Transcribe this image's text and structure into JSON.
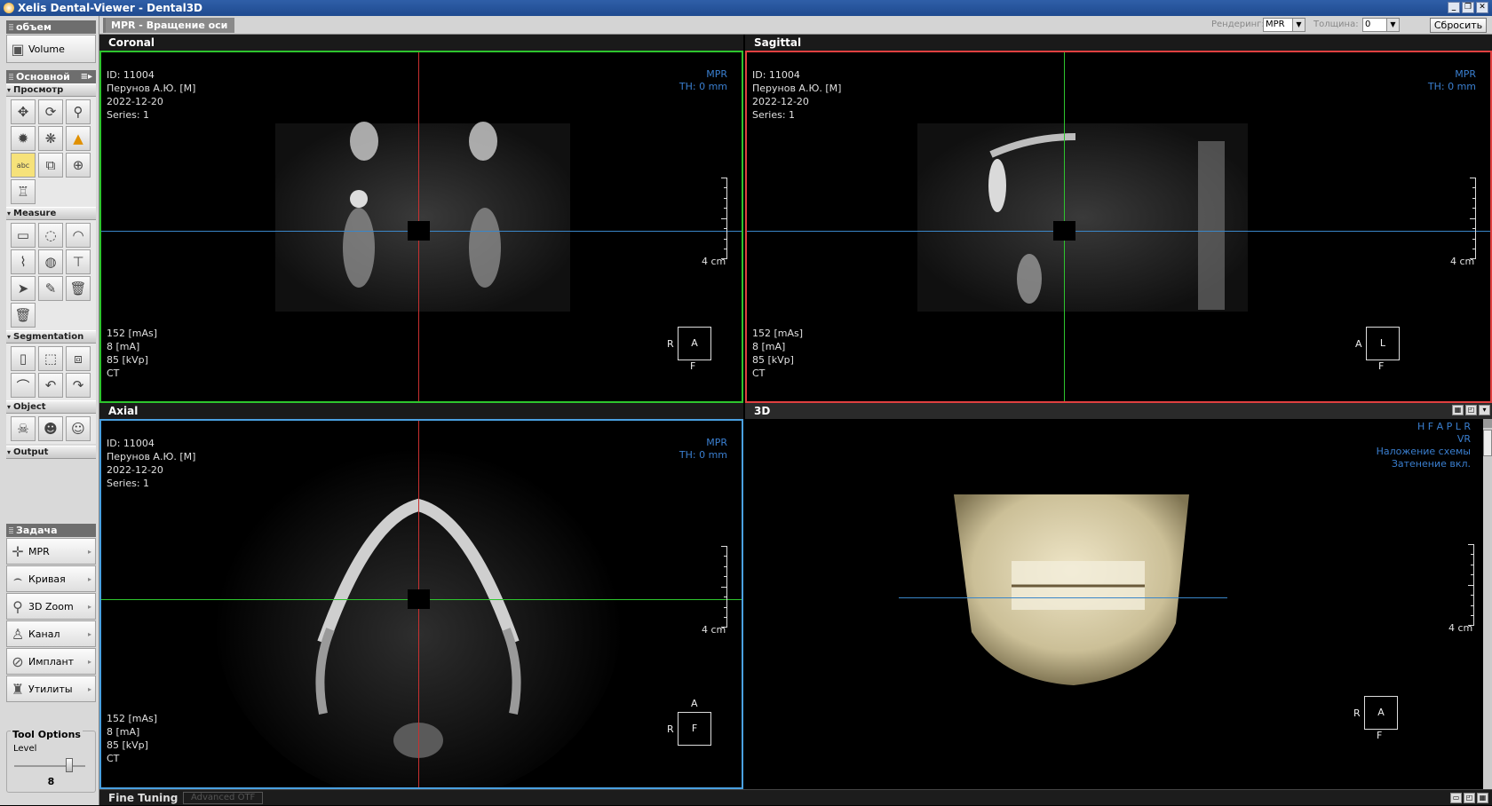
{
  "app": {
    "title": "Xelis Dental-Viewer - Dental3D"
  },
  "sidebar": {
    "volume_panel": {
      "title": "объем",
      "button": "Volume"
    },
    "main_panel": {
      "title": "Основной",
      "sections": {
        "view": "Просмотр",
        "measure": "Measure",
        "segmentation": "Segmentation",
        "object": "Object",
        "output": "Output"
      },
      "view_tools": [
        "move-icon",
        "rotate-icon",
        "zoom-icon",
        "brightness-icon",
        "rotate-3d-icon",
        "warning-icon",
        "text-annotation-icon",
        "copy-icon",
        "target-icon",
        "tooth-icon"
      ],
      "measure_tools": [
        "ruler-icon",
        "area-icon",
        "angle-icon",
        "profile-icon",
        "globe-icon",
        "arrow-annotation-icon",
        "select-icon",
        "eraser-icon",
        "delete-icon",
        "delete-all-icon"
      ],
      "segmentation_tools": [
        "brush-icon",
        "sculpt-icon",
        "merge-icon",
        "cut-icon",
        "undo-icon",
        "redo-icon"
      ],
      "object_tools": [
        "skull-icon",
        "head-icon",
        "face-icon"
      ]
    },
    "task_panel": {
      "title": "Задача",
      "items": [
        {
          "label": "MPR",
          "icon": "mpr-icon"
        },
        {
          "label": "Кривая",
          "icon": "curve-icon"
        },
        {
          "label": "3D Zoom",
          "icon": "zoom-3d-icon"
        },
        {
          "label": "Канал",
          "icon": "canal-icon"
        },
        {
          "label": "Имплант",
          "icon": "implant-icon"
        },
        {
          "label": "Утилиты",
          "icon": "utilities-icon"
        }
      ]
    },
    "tool_options": {
      "title": "Tool Options",
      "level_label": "Level",
      "level_value": "8",
      "level_fraction": 0.8
    }
  },
  "modebar": {
    "title": "MPR - Вращение оси",
    "render_label": "Рендеринг:",
    "render_value": "MPR",
    "thickness_label": "Толщина:",
    "thickness_value": "0",
    "reset": "Сбросить"
  },
  "viewports": {
    "coronal": {
      "title": "Coronal",
      "id": "ID: 11004",
      "patient": "Перунов А.Ю. [M]",
      "date": "2022-12-20",
      "series": "Series: 1",
      "mode": "MPR",
      "th": "TH: 0 mm",
      "mas": "152 [mAs]",
      "ma": "8 [mA]",
      "kvp": "85 [kVp]",
      "modality": "CT",
      "scale": "4 cm",
      "orient_left": "R",
      "orient_box": "A",
      "orient_bottom": "F",
      "border": "#2ec52e"
    },
    "sagittal": {
      "title": "Sagittal",
      "id": "ID: 11004",
      "patient": "Перунов А.Ю. [M]",
      "date": "2022-12-20",
      "series": "Series: 1",
      "mode": "MPR",
      "th": "TH: 0 mm",
      "mas": "152 [mAs]",
      "ma": "8 [mA]",
      "kvp": "85 [kVp]",
      "modality": "CT",
      "scale": "4 cm",
      "orient_left": "A",
      "orient_box": "L",
      "orient_bottom": "F",
      "border": "#e04040"
    },
    "axial": {
      "title": "Axial",
      "id": "ID: 11004",
      "patient": "Перунов А.Ю. [M]",
      "date": "2022-12-20",
      "series": "Series: 1",
      "mode": "MPR",
      "th": "TH: 0 mm",
      "mas": "152 [mAs]",
      "ma": "8 [mA]",
      "kvp": "85 [kVp]",
      "modality": "CT",
      "scale": "4 cm",
      "orient_top": "A",
      "orient_left": "R",
      "orient_box": "F",
      "border": "#4aa0e0"
    },
    "view3d": {
      "title": "3D",
      "orientation": "H F A P L R",
      "mode": "VR",
      "overlay": "Наложение схемы",
      "shading": "Затенение вкл.",
      "scale": "4 cm",
      "orient_left": "R",
      "orient_box": "A",
      "orient_bottom": "F"
    }
  },
  "finebar": {
    "title": "Fine Tuning",
    "advanced": "Advanced OTF"
  }
}
